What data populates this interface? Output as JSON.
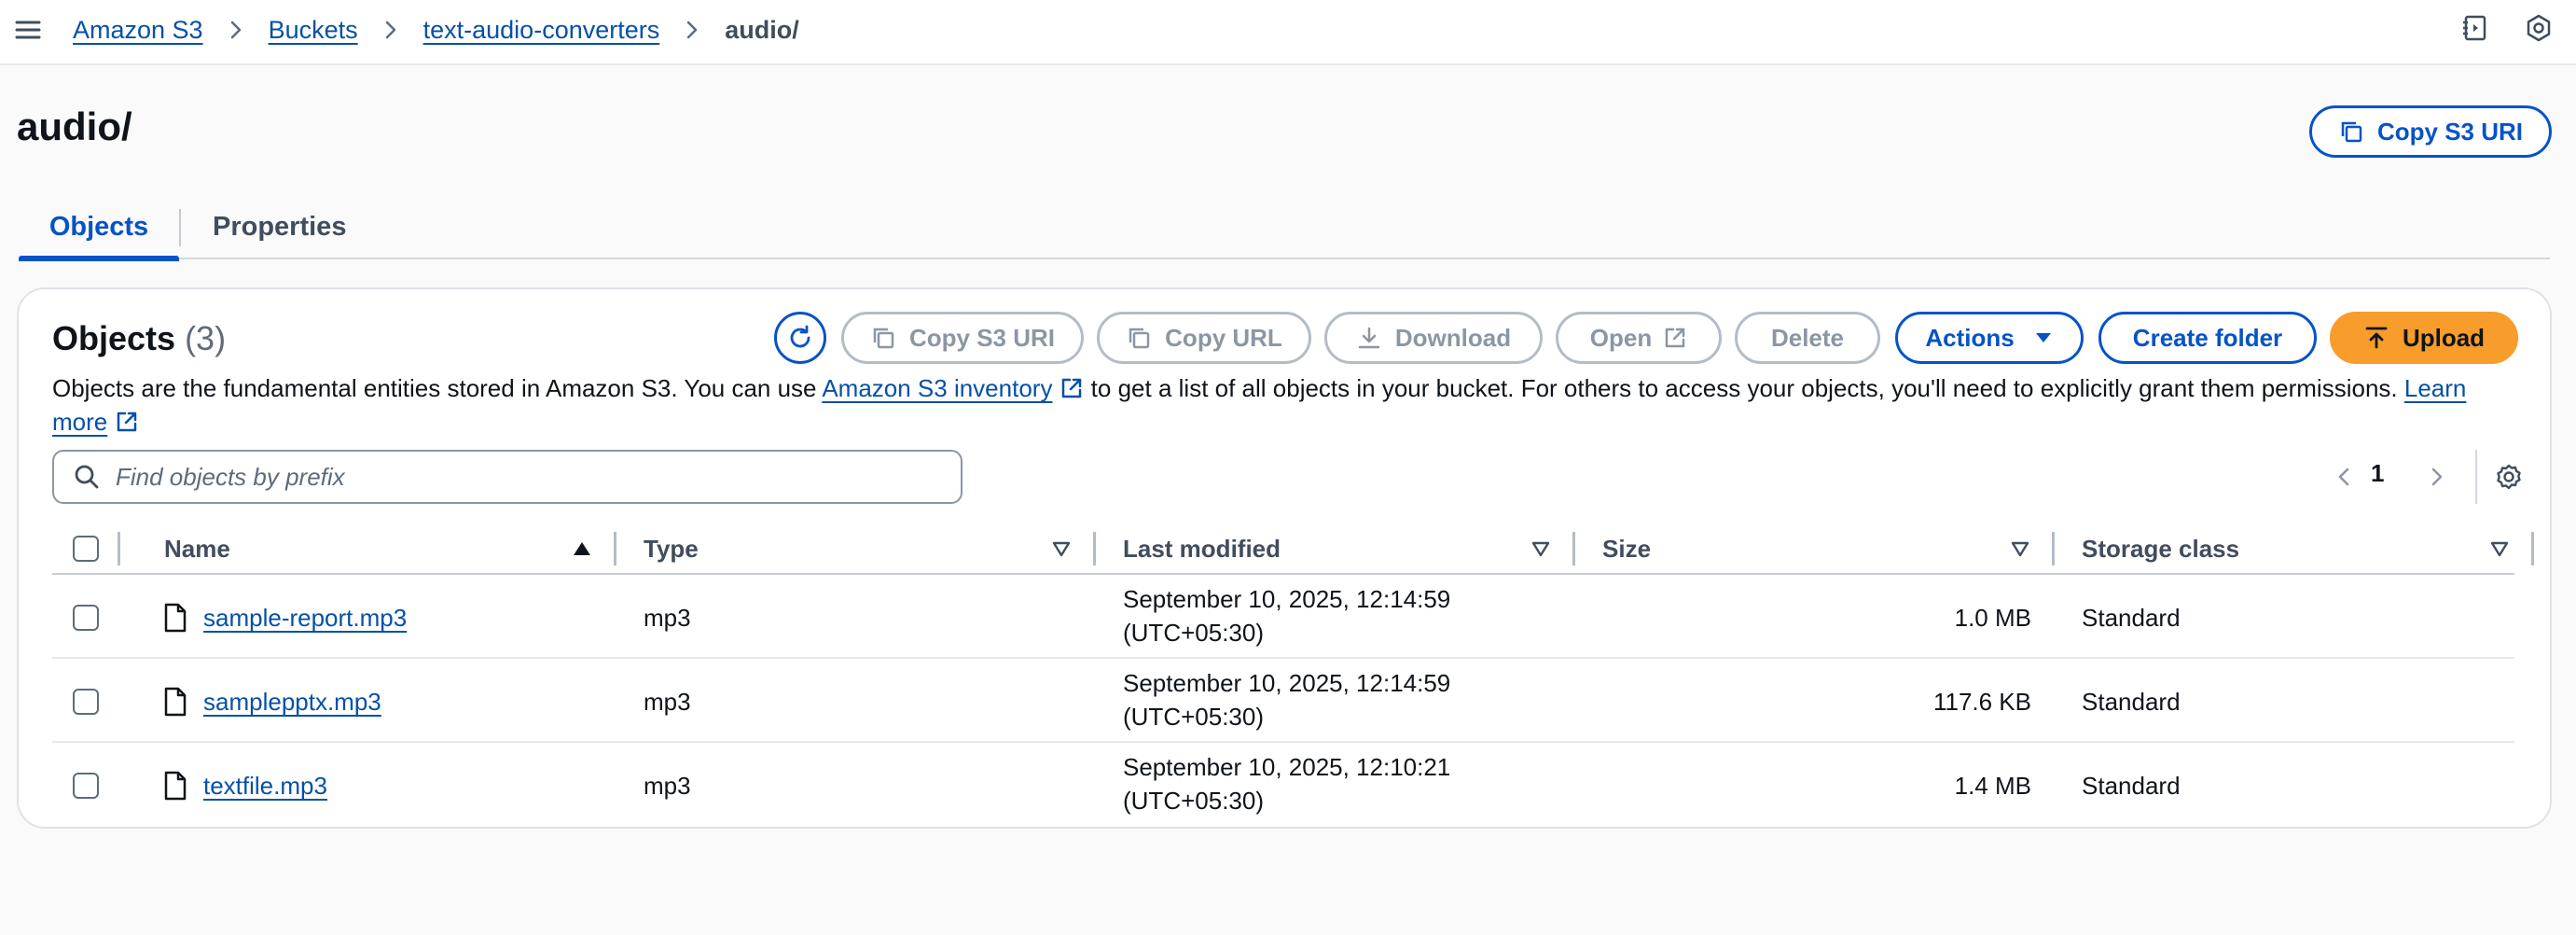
{
  "breadcrumb": {
    "items": [
      "Amazon S3",
      "Buckets",
      "text-audio-converters"
    ],
    "current": "audio/"
  },
  "header": {
    "title": "audio/",
    "copy_s3_uri": "Copy S3 URI"
  },
  "tabs": [
    "Objects",
    "Properties"
  ],
  "objects_panel": {
    "title": "Objects",
    "count": "(3)",
    "buttons": {
      "copy_s3_uri": "Copy S3 URI",
      "copy_url": "Copy URL",
      "download": "Download",
      "open": "Open",
      "delete": "Delete",
      "actions": "Actions",
      "create_folder": "Create folder",
      "upload": "Upload"
    },
    "description": {
      "part1": "Objects are the fundamental entities stored in Amazon S3. You can use ",
      "inventory_link": "Amazon S3 inventory",
      "part2": " to get a list of all objects in your bucket. For others to access your objects, you'll need to explicitly grant them permissions. ",
      "learn_more_link": "Learn more"
    },
    "search_placeholder": "Find objects by prefix",
    "page": "1"
  },
  "table": {
    "columns": [
      "Name",
      "Type",
      "Last modified",
      "Size",
      "Storage class"
    ],
    "rows": [
      {
        "name": "sample-report.mp3",
        "type": "mp3",
        "modified_line1": "September 10, 2025, 12:14:59",
        "modified_line2": "(UTC+05:30)",
        "size": "1.0 MB",
        "storage": "Standard"
      },
      {
        "name": "samplepptx.mp3",
        "type": "mp3",
        "modified_line1": "September 10, 2025, 12:14:59",
        "modified_line2": "(UTC+05:30)",
        "size": "117.6 KB",
        "storage": "Standard"
      },
      {
        "name": "textfile.mp3",
        "type": "mp3",
        "modified_line1": "September 10, 2025, 12:10:21",
        "modified_line2": "(UTC+05:30)",
        "size": "1.4 MB",
        "storage": "Standard"
      }
    ]
  },
  "colors": {
    "link": "#0550a8",
    "primary_blue": "#0653c7",
    "upload_orange": "#f89c2b",
    "disabled_gray": "#8c96a3"
  },
  "icons": [
    "menu-icon",
    "chevron-right-icon",
    "notes-icon",
    "settings-hex-icon",
    "copy-icon",
    "refresh-icon",
    "download-icon",
    "external-link-icon",
    "caret-down-icon",
    "upload-icon",
    "search-icon",
    "chevron-left-icon",
    "gear-icon",
    "sort-ascending-icon",
    "sort-icon",
    "file-icon"
  ]
}
